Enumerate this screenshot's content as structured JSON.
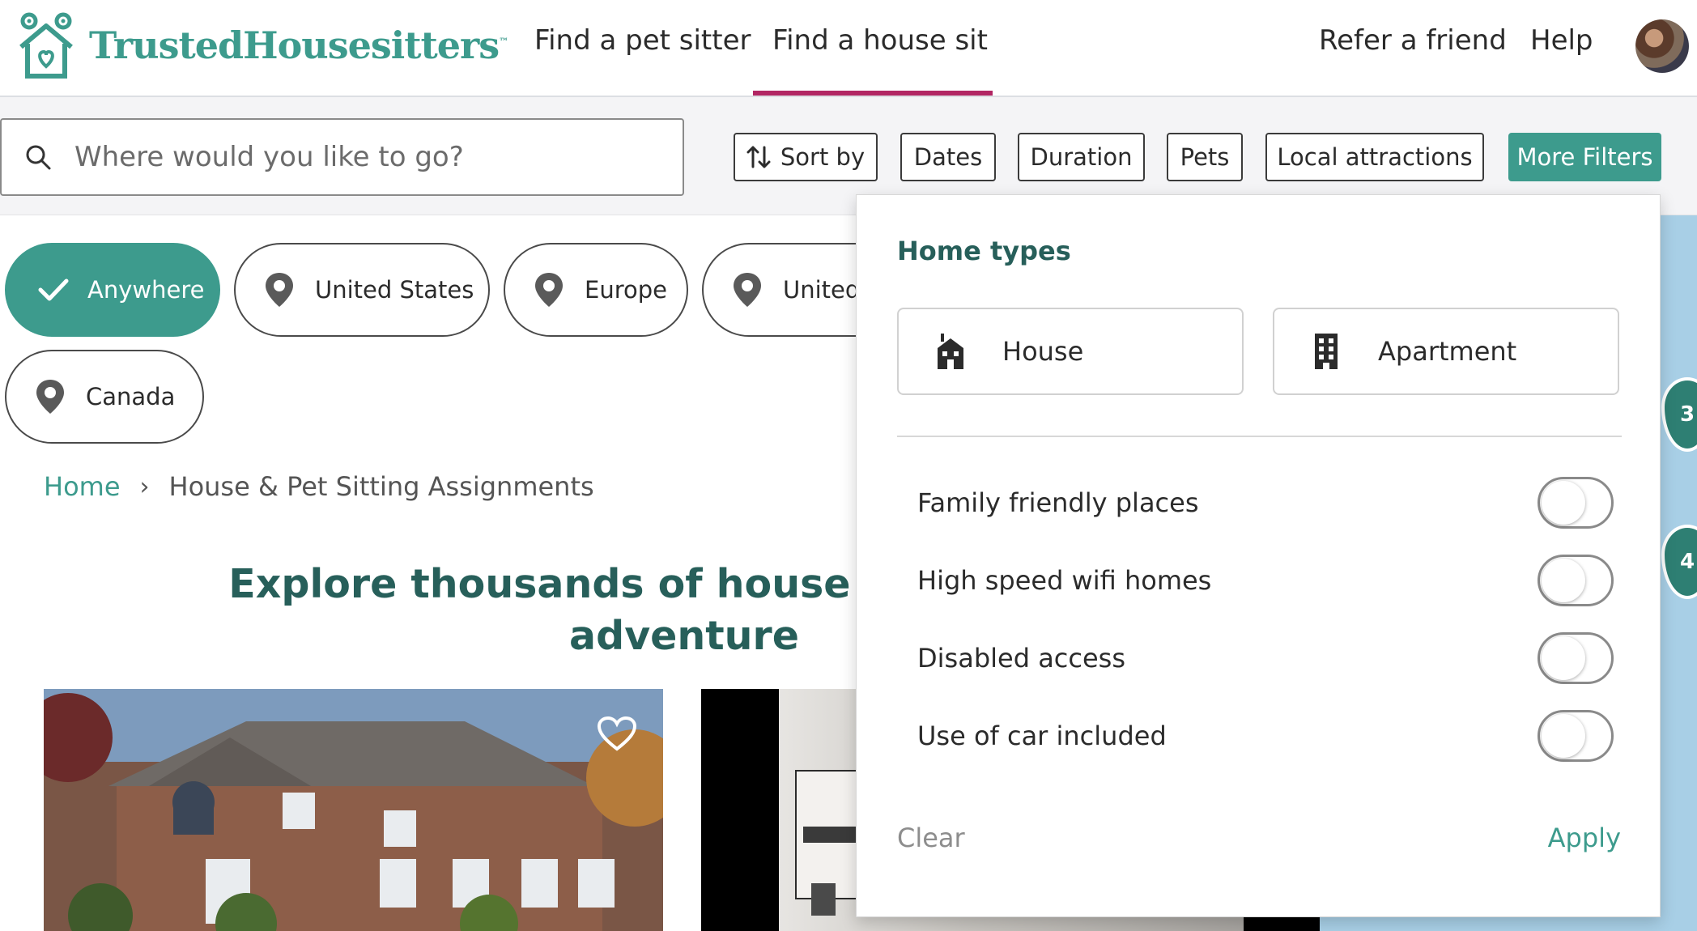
{
  "brand": {
    "name": "TrustedHousesitters",
    "tm": "™",
    "color": "#3d9b8d"
  },
  "nav": {
    "find_pet_sitter": "Find a pet sitter",
    "find_house_sit": "Find a house sit",
    "refer": "Refer a friend",
    "help": "Help"
  },
  "search": {
    "placeholder": "Where would you like to go?"
  },
  "filters": {
    "sort_by": "Sort by",
    "dates": "Dates",
    "duration": "Duration",
    "pets": "Pets",
    "local_attractions": "Local attractions",
    "more_filters": "More Filters"
  },
  "chips": {
    "anywhere": "Anywhere",
    "united_states": "United States",
    "europe": "Europe",
    "united_partial": "United",
    "canada": "Canada"
  },
  "breadcrumb": {
    "home": "Home",
    "current": "House & Pet Sitting Assignments"
  },
  "headline": {
    "line1": "Explore thousands of house sits and fine",
    "line2": "adventure"
  },
  "map": {
    "markers": [
      "3",
      "4"
    ]
  },
  "more_filters_panel": {
    "title": "Home types",
    "home_types": [
      "House",
      "Apartment"
    ],
    "toggles": [
      {
        "label": "Family friendly places",
        "on": false
      },
      {
        "label": "High speed wifi homes",
        "on": false
      },
      {
        "label": "Disabled access",
        "on": false
      },
      {
        "label": "Use of car included",
        "on": false
      }
    ],
    "clear": "Clear",
    "apply": "Apply"
  },
  "colors": {
    "teal": "#3d9b8d",
    "dark_teal": "#275f5a",
    "accent": "#b22663"
  }
}
